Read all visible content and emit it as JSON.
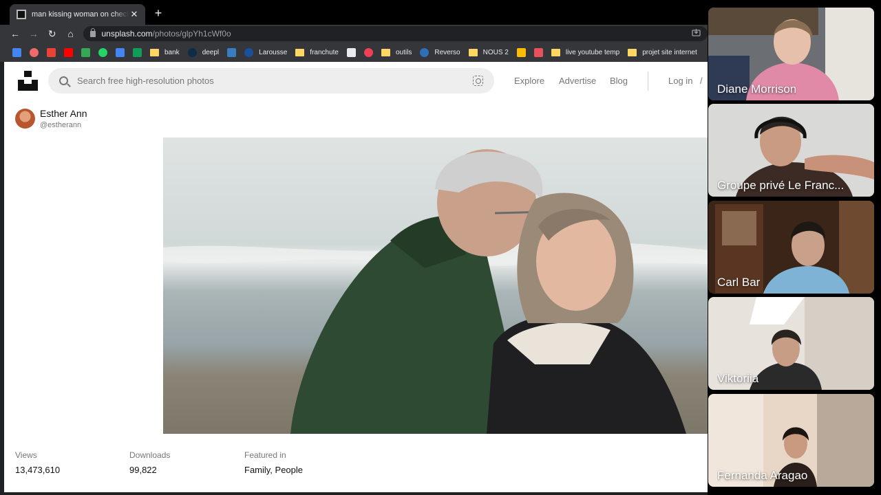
{
  "browser": {
    "tab_title": "man kissing woman on check beside body of water photo",
    "tab_close": "✕",
    "new_tab": "+",
    "nav": {
      "back": "←",
      "forward": "→",
      "reload": "↻",
      "home": "⌂"
    },
    "url_host": "unsplash.com",
    "url_path": "/photos/glpYh1cWf0o",
    "bookmarks": [
      {
        "label": "",
        "icon": "calendar-icon",
        "color": "#4285f4"
      },
      {
        "label": "",
        "icon": "asana-icon",
        "color": "#f06a6a"
      },
      {
        "label": "",
        "icon": "gmail-icon",
        "color": "#ea4335"
      },
      {
        "label": "",
        "icon": "youtube-icon",
        "color": "#ff0000"
      },
      {
        "label": "",
        "icon": "drive-icon",
        "color": "#34a853"
      },
      {
        "label": "",
        "icon": "whatsapp-icon",
        "color": "#25d366"
      },
      {
        "label": "",
        "icon": "docs-icon",
        "color": "#4285f4"
      },
      {
        "label": "",
        "icon": "sheets-icon",
        "color": "#0f9d58"
      },
      {
        "label": "bank",
        "icon": "folder-icon",
        "color": "#fdd663"
      },
      {
        "label": "deepl",
        "icon": "deepl-icon",
        "color": "#0f2b46"
      },
      {
        "label": "",
        "icon": "reverso-r-icon",
        "color": "#3b7bbf"
      },
      {
        "label": "Larousse",
        "icon": "larousse-icon",
        "color": "#1a4f9c"
      },
      {
        "label": "franchute",
        "icon": "folder-icon",
        "color": "#fdd663"
      },
      {
        "label": "",
        "icon": "page-icon",
        "color": "#e8eaed"
      },
      {
        "label": "",
        "icon": "pocket-icon",
        "color": "#ef4056"
      },
      {
        "label": "outils",
        "icon": "folder-icon",
        "color": "#fdd663"
      },
      {
        "label": "Reverso",
        "icon": "reverso-icon",
        "color": "#2f6fb5"
      },
      {
        "label": "NOUS 2",
        "icon": "folder-icon",
        "color": "#fdd663"
      },
      {
        "label": "",
        "icon": "keep-icon",
        "color": "#fbbc04"
      },
      {
        "label": "",
        "icon": "app-icon",
        "color": "#e8505b"
      },
      {
        "label": "live youtube temp",
        "icon": "folder-icon",
        "color": "#fdd663"
      },
      {
        "label": "projet site internet",
        "icon": "folder-icon",
        "color": "#fdd663"
      }
    ]
  },
  "unsplash": {
    "search_placeholder": "Search free high-resolution photos",
    "nav": {
      "explore": "Explore",
      "advertise": "Advertise",
      "blog": "Blog",
      "login": "Log in",
      "separator": "/"
    },
    "author": {
      "name": "Esther Ann",
      "handle": "@estherann"
    },
    "stats": [
      {
        "label": "Views",
        "value": "13,473,610"
      },
      {
        "label": "Downloads",
        "value": "99,822"
      },
      {
        "label": "Featured in",
        "value": "Family, People"
      }
    ]
  },
  "call": {
    "participants": [
      {
        "name": "Diane Morrison",
        "speaking": false
      },
      {
        "name": "Groupe privé Le Franc...",
        "speaking": true
      },
      {
        "name": "Carl Bar",
        "speaking": false
      },
      {
        "name": "Viktoriia",
        "speaking": false
      },
      {
        "name": "Fernanda Aragao",
        "speaking": false
      }
    ]
  }
}
